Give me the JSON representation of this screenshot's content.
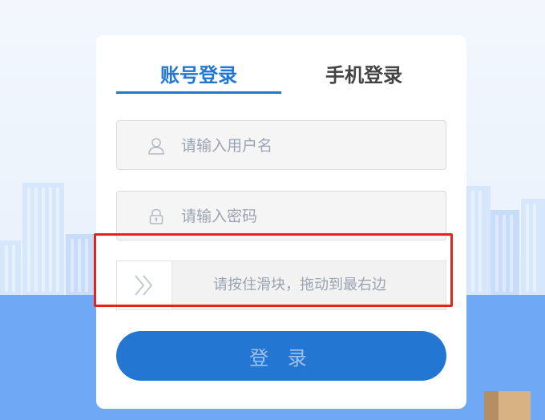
{
  "tabs": {
    "account": "账号登录",
    "phone": "手机登录"
  },
  "form": {
    "username_placeholder": "请输入用户名",
    "password_placeholder": "请输入密码",
    "slider_text": "请按住滑块，拖动到最右边",
    "login_label": "登 录"
  },
  "colors": {
    "accent": "#2377d3",
    "highlight": "#e4231b"
  }
}
